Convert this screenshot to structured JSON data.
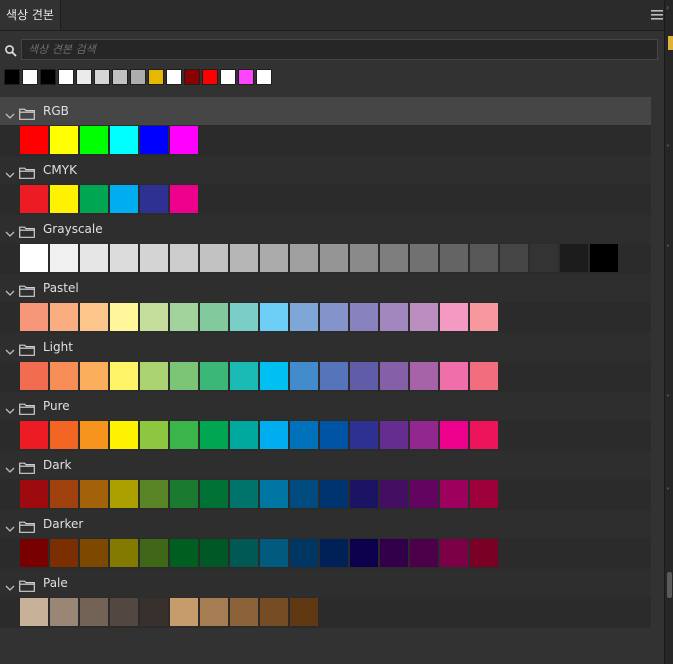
{
  "panel": {
    "tab_label": "색상 견본",
    "menu_icon": "hamburger-menu-icon"
  },
  "search": {
    "placeholder": "색상 견본 검색",
    "value": "",
    "icon": "search-icon"
  },
  "recent_swatches": [
    "#000000",
    "#ffffff",
    "#000000",
    "#ffffff",
    "#ebebeb",
    "#d6d6d6",
    "#c2c2c2",
    "#adadad",
    "#e6b800",
    "#ffffff",
    "#8b0000",
    "#ff0000",
    "#ffffff",
    "#ff44ff",
    "#ffffff"
  ],
  "groups": [
    {
      "name": "RGB",
      "selected": true,
      "swatches": [
        "#ff0000",
        "#ffff00",
        "#00ff00",
        "#00ffff",
        "#0000ff",
        "#ff00ff"
      ]
    },
    {
      "name": "CMYK",
      "selected": false,
      "swatches": [
        "#ed1c24",
        "#fff200",
        "#00a651",
        "#00aeef",
        "#2e3192",
        "#ec008c"
      ]
    },
    {
      "name": "Grayscale",
      "selected": false,
      "swatches": [
        "#ffffff",
        "#f0f0f0",
        "#e6e6e6",
        "#dcdcdc",
        "#d4d4d4",
        "#cccccc",
        "#c2c2c2",
        "#b6b6b6",
        "#ababab",
        "#a0a0a0",
        "#959595",
        "#8a8a8a",
        "#7e7e7e",
        "#717171",
        "#646464",
        "#575757",
        "#454545",
        "#333333",
        "#1c1c1c",
        "#000000"
      ]
    },
    {
      "name": "Pastel",
      "selected": false,
      "swatches": [
        "#f7977a",
        "#f9ad81",
        "#fdc68a",
        "#fff79a",
        "#c4df9b",
        "#a2d39c",
        "#82ca9d",
        "#7bcdc8",
        "#6ecff6",
        "#7ea7d8",
        "#8493ca",
        "#8882be",
        "#a187be",
        "#bc8dbf",
        "#f49ac2",
        "#f6989d"
      ]
    },
    {
      "name": "Light",
      "selected": false,
      "swatches": [
        "#f26c4f",
        "#f68e55",
        "#fbaf5c",
        "#fff467",
        "#acd372",
        "#7cc576",
        "#3bb878",
        "#1abbb4",
        "#00bff3",
        "#438ccb",
        "#5574b9",
        "#605ca8",
        "#855fa8",
        "#a763a8",
        "#f06ea9",
        "#f26d7d"
      ]
    },
    {
      "name": "Pure",
      "selected": false,
      "swatches": [
        "#ed1c24",
        "#f26522",
        "#f7941d",
        "#fff200",
        "#8dc73f",
        "#39b54a",
        "#00a651",
        "#00a99d",
        "#00aeef",
        "#0072bc",
        "#0054a6",
        "#2e3192",
        "#662d91",
        "#92278f",
        "#ec008c",
        "#ed145b"
      ]
    },
    {
      "name": "Dark",
      "selected": false,
      "swatches": [
        "#9e0b0f",
        "#a0410d",
        "#a36209",
        "#aba000",
        "#598527",
        "#1a7b30",
        "#007236",
        "#00746b",
        "#0076a3",
        "#004b80",
        "#003471",
        "#1b1464",
        "#440e62",
        "#630460",
        "#9e005d",
        "#9e0039"
      ]
    },
    {
      "name": "Darker",
      "selected": false,
      "swatches": [
        "#790000",
        "#7b2e00",
        "#7d4900",
        "#827b00",
        "#406618",
        "#005e20",
        "#005826",
        "#005952",
        "#005b7f",
        "#003663",
        "#002157",
        "#0d004c",
        "#32004b",
        "#4b0049",
        "#7b0046",
        "#7a0026"
      ]
    },
    {
      "name": "Pale",
      "selected": false,
      "swatches": [
        "#c7b299",
        "#998675",
        "#736357",
        "#534741",
        "#37302d",
        "#c69c6d",
        "#a67c52",
        "#8c6239",
        "#754c24",
        "#603913"
      ]
    }
  ]
}
